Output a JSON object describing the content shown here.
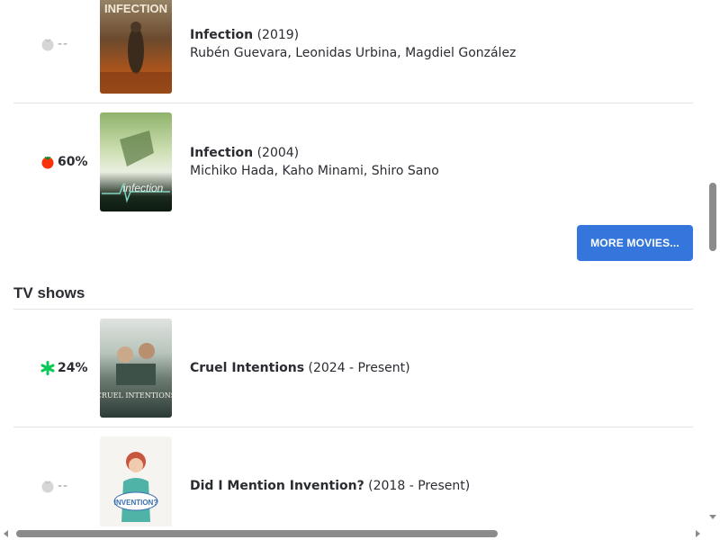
{
  "movies": [
    {
      "score_text": "--",
      "score_icon": "empty-tomato-icon",
      "title": "Infection",
      "year": "(2019)",
      "cast": "Rubén Guevara, Leonidas Urbina, Magdiel González",
      "poster_text": "INFECTION"
    },
    {
      "score_text": "60%",
      "score_icon": "fresh-tomato-icon",
      "title": "Infection",
      "year": "(2004)",
      "cast": "Michiko Hada, Kaho Minami, Shiro Sano",
      "poster_text": "infection"
    }
  ],
  "more_movies_label": "MORE MOVIES...",
  "tv_section_title": "TV shows",
  "tv_shows": [
    {
      "score_text": "24%",
      "score_icon": "rotten-splat-icon",
      "title": "Cruel Intentions",
      "years": "(2024 - Present)",
      "poster_text": "CRUEL INTENTIONS"
    },
    {
      "score_text": "--",
      "score_icon": "empty-tomato-icon",
      "title": "Did I Mention Invention?",
      "years": "(2018 - Present)",
      "poster_text": "INVENTION?"
    }
  ],
  "colors": {
    "button": "#3476dc",
    "fresh": "#fa320a",
    "rotten": "#0ac855",
    "text": "#2a2c32",
    "divider": "#e3e3e3"
  }
}
